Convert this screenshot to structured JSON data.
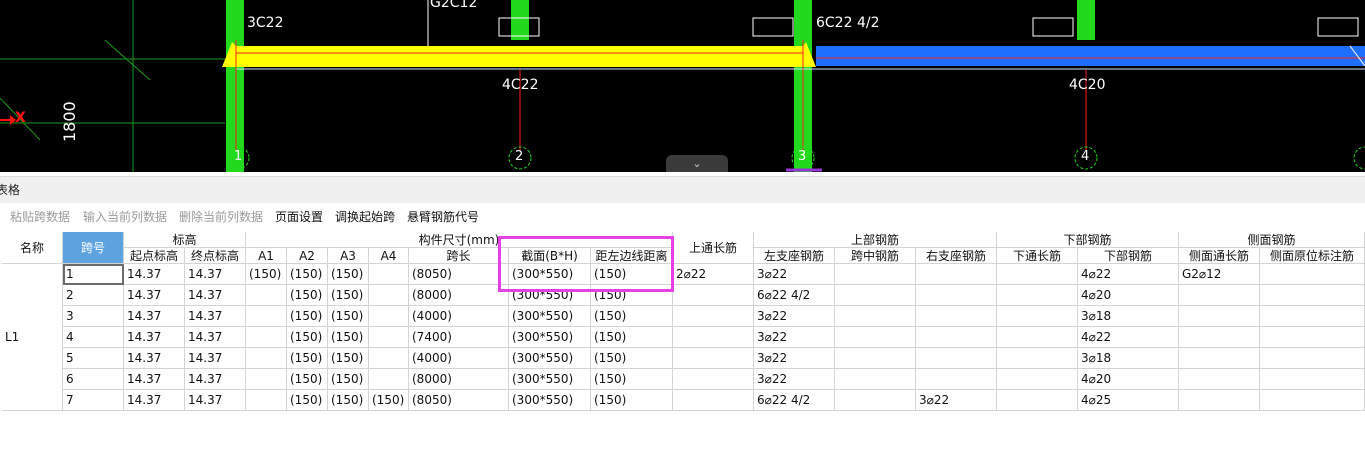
{
  "cad": {
    "labels": {
      "top_left": "3C22",
      "top_mid": "G2C12",
      "top_right": "6C22 4/2",
      "bottom_left": "4C22",
      "bottom_right": "4C20",
      "dimension": "1800",
      "axis": "X"
    },
    "axis_numbers": [
      "1",
      "2",
      "3",
      "4"
    ],
    "colors": {
      "beam_yellow": "#ffff00",
      "beam_blue": "#1f6fff",
      "column_green": "#22d91e",
      "axis_red": "#ff1010"
    }
  },
  "panel": {
    "title": "表格"
  },
  "toolbar": {
    "paste": "粘贴跨数据",
    "input_col": "输入当前列数据",
    "delete_col": "删除当前列数据",
    "page_setup": "页面设置",
    "swap_start": "调换起始跨",
    "cantilever": "悬臂钢筋代号"
  },
  "table": {
    "headers": {
      "name": "名称",
      "span": "跨号",
      "elevation": "标高",
      "start_elev": "起点标高",
      "end_elev": "终点标高",
      "dims": "构件尺寸(mm)",
      "a1": "A1",
      "a2": "A2",
      "a3": "A3",
      "a4": "A4",
      "span_len": "跨长",
      "section": "截面(B*H)",
      "offset": "距左边线距离",
      "top_through": "上通长筋",
      "top_rebar": "上部钢筋",
      "left_support": "左支座钢筋",
      "mid_span": "跨中钢筋",
      "right_support": "右支座钢筋",
      "bottom_rebar": "下部钢筋",
      "bottom_through": "下通长筋",
      "bottom_main": "下部钢筋",
      "side_rebar": "侧面钢筋",
      "side_through": "侧面通长筋",
      "side_orig": "侧面原位标注筋"
    },
    "name_value": "L1",
    "rows": [
      {
        "span": "1",
        "start": "14.37",
        "end": "14.37",
        "a1": "(150)",
        "a2": "(150)",
        "a3": "(150)",
        "a4": "",
        "len": "(8050)",
        "sec": "(300*550)",
        "off": "(150)",
        "top": "2⌀22",
        "left": "3⌀22",
        "mid": "",
        "right": "",
        "bthru": "",
        "bottom": "4⌀22",
        "side": "G2⌀12",
        "sideorig": ""
      },
      {
        "span": "2",
        "start": "14.37",
        "end": "14.37",
        "a1": "",
        "a2": "(150)",
        "a3": "(150)",
        "a4": "",
        "len": "(8000)",
        "sec": "(300*550)",
        "off": "(150)",
        "top": "",
        "left": "6⌀22 4/2",
        "mid": "",
        "right": "",
        "bthru": "",
        "bottom": "4⌀20",
        "side": "",
        "sideorig": ""
      },
      {
        "span": "3",
        "start": "14.37",
        "end": "14.37",
        "a1": "",
        "a2": "(150)",
        "a3": "(150)",
        "a4": "",
        "len": "(4000)",
        "sec": "(300*550)",
        "off": "(150)",
        "top": "",
        "left": "3⌀22",
        "mid": "",
        "right": "",
        "bthru": "",
        "bottom": "3⌀18",
        "side": "",
        "sideorig": ""
      },
      {
        "span": "4",
        "start": "14.37",
        "end": "14.37",
        "a1": "",
        "a2": "(150)",
        "a3": "(150)",
        "a4": "",
        "len": "(7400)",
        "sec": "(300*550)",
        "off": "(150)",
        "top": "",
        "left": "3⌀22",
        "mid": "",
        "right": "",
        "bthru": "",
        "bottom": "4⌀22",
        "side": "",
        "sideorig": ""
      },
      {
        "span": "5",
        "start": "14.37",
        "end": "14.37",
        "a1": "",
        "a2": "(150)",
        "a3": "(150)",
        "a4": "",
        "len": "(4000)",
        "sec": "(300*550)",
        "off": "(150)",
        "top": "",
        "left": "3⌀22",
        "mid": "",
        "right": "",
        "bthru": "",
        "bottom": "3⌀18",
        "side": "",
        "sideorig": ""
      },
      {
        "span": "6",
        "start": "14.37",
        "end": "14.37",
        "a1": "",
        "a2": "(150)",
        "a3": "(150)",
        "a4": "",
        "len": "(8000)",
        "sec": "(300*550)",
        "off": "(150)",
        "top": "",
        "left": "3⌀22",
        "mid": "",
        "right": "",
        "bthru": "",
        "bottom": "4⌀20",
        "side": "",
        "sideorig": ""
      },
      {
        "span": "7",
        "start": "14.37",
        "end": "14.37",
        "a1": "",
        "a2": "(150)",
        "a3": "(150)",
        "a4": "(150)",
        "len": "(8050)",
        "sec": "(300*550)",
        "off": "(150)",
        "top": "",
        "left": "6⌀22 4/2",
        "mid": "",
        "right": "3⌀22",
        "bthru": "",
        "bottom": "4⌀25",
        "side": "",
        "sideorig": ""
      }
    ]
  }
}
